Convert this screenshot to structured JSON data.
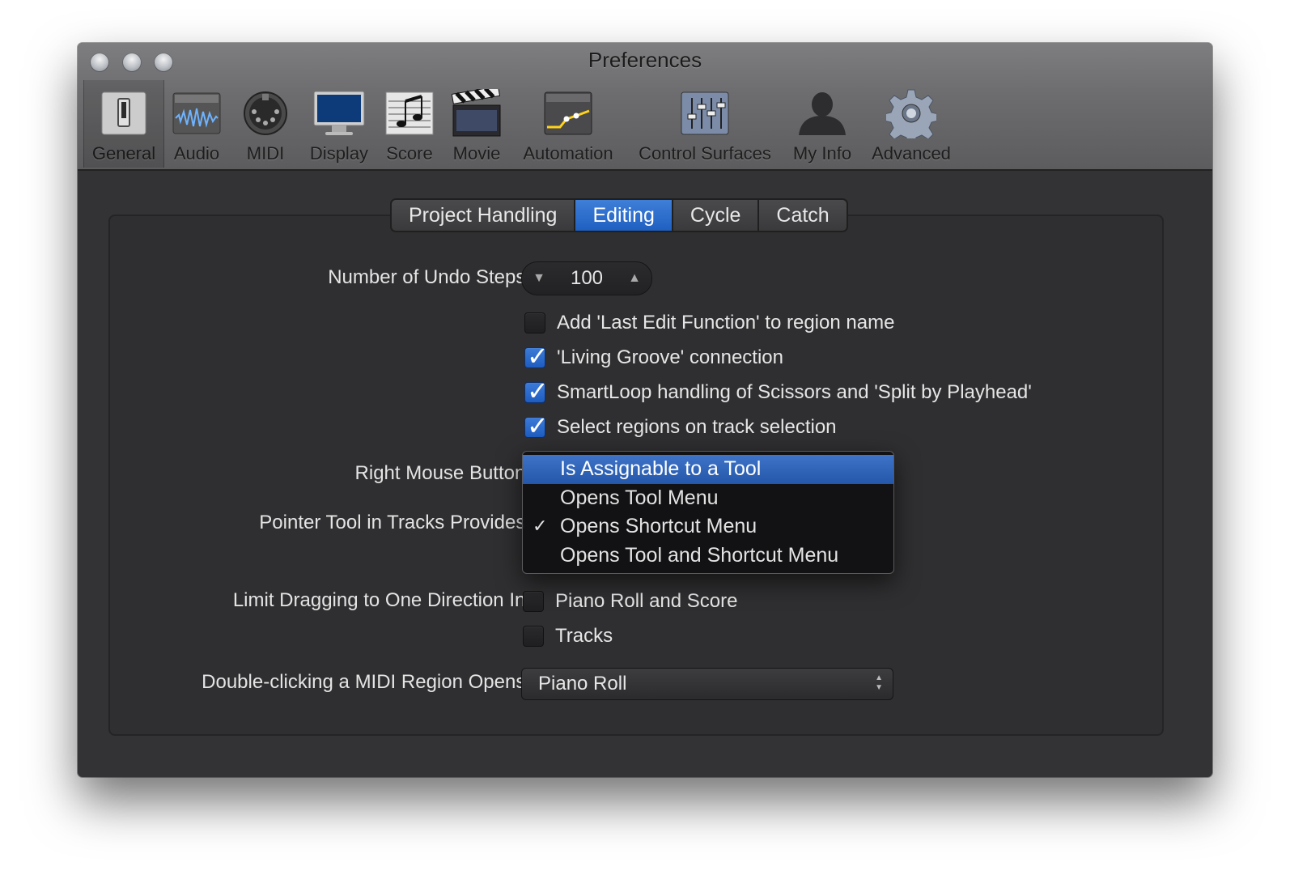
{
  "window": {
    "title": "Preferences"
  },
  "toolbar": {
    "items": [
      {
        "label": "General",
        "icon": "general-switch-icon"
      },
      {
        "label": "Audio",
        "icon": "audio-waveform-icon"
      },
      {
        "label": "MIDI",
        "icon": "midi-connector-icon"
      },
      {
        "label": "Display",
        "icon": "display-monitor-icon"
      },
      {
        "label": "Score",
        "icon": "score-notes-icon"
      },
      {
        "label": "Movie",
        "icon": "movie-clapper-icon"
      },
      {
        "label": "Automation",
        "icon": "automation-curve-icon"
      },
      {
        "label": "Control Surfaces",
        "icon": "control-surfaces-faders-icon"
      },
      {
        "label": "My Info",
        "icon": "my-info-person-icon"
      },
      {
        "label": "Advanced",
        "icon": "advanced-gear-icon"
      }
    ],
    "selected": "General"
  },
  "tabs": [
    {
      "label": "Project Handling",
      "active": false
    },
    {
      "label": "Editing",
      "active": true
    },
    {
      "label": "Cycle",
      "active": false
    },
    {
      "label": "Catch",
      "active": false
    }
  ],
  "settings": {
    "undo_label": "Number of Undo Steps:",
    "undo_value": "100",
    "checks": [
      {
        "label": "Add 'Last Edit Function' to region name",
        "checked": false
      },
      {
        "label": "'Living Groove' connection",
        "checked": true
      },
      {
        "label": "SmartLoop handling of Scissors and 'Split by Playhead'",
        "checked": true
      },
      {
        "label": "Select regions on track selection",
        "checked": true
      }
    ],
    "right_mouse_label": "Right Mouse Button:",
    "pointer_tool_label": "Pointer Tool in Tracks Provides:",
    "limit_drag_label": "Limit Dragging to One Direction In:",
    "limit_drag_options": [
      {
        "label": "Piano Roll and Score",
        "checked": false
      },
      {
        "label": "Tracks",
        "checked": false
      }
    ],
    "double_click_label": "Double-clicking a MIDI Region Opens:",
    "double_click_value": "Piano Roll"
  },
  "right_mouse_menu": {
    "options": [
      {
        "label": "Is Assignable to a Tool",
        "highlighted": true,
        "checked": false
      },
      {
        "label": "Opens Tool Menu",
        "highlighted": false,
        "checked": false
      },
      {
        "label": "Opens Shortcut Menu",
        "highlighted": false,
        "checked": true
      },
      {
        "label": "Opens Tool and Shortcut Menu",
        "highlighted": false,
        "checked": false
      }
    ],
    "check_mark": "✓"
  },
  "colors": {
    "accent": "#2a64c4",
    "window_bg": "#333336",
    "titlebar": "#6d6d6f"
  }
}
